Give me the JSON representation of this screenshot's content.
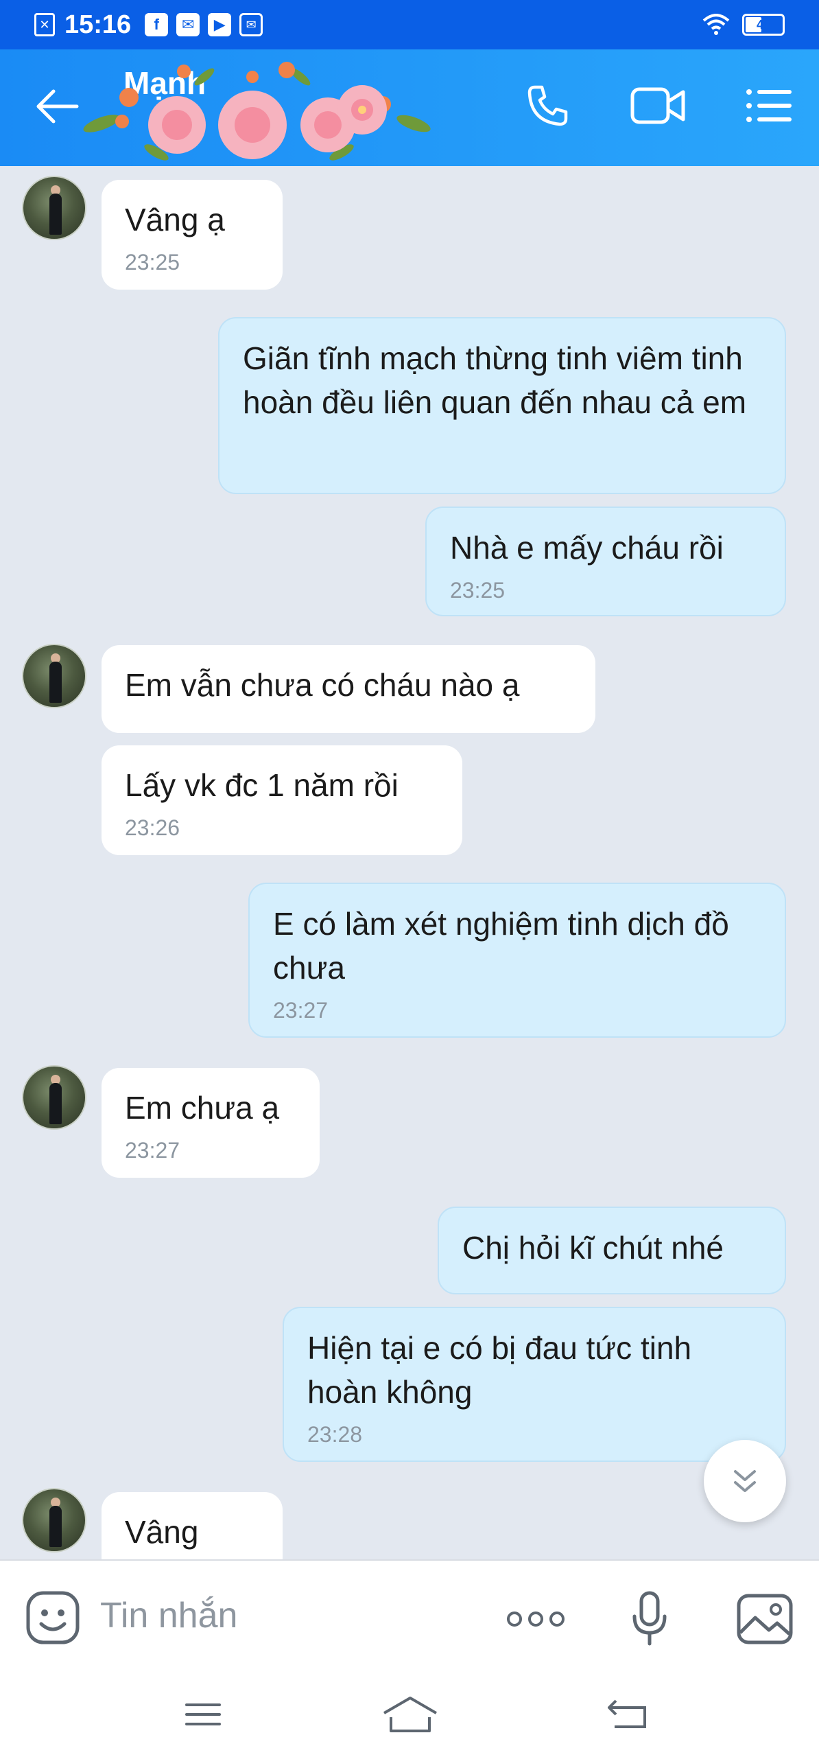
{
  "status_bar": {
    "time": "15:16",
    "battery": "48",
    "battery_level": 0.48,
    "icons": [
      "sim-icon",
      "facebook-icon",
      "mail-icon",
      "youtube-icon",
      "message-icon",
      "wifi-icon",
      "battery-icon"
    ]
  },
  "header": {
    "contact_name": "Mạnh",
    "icons": [
      "back-arrow-icon",
      "phone-icon",
      "video-call-icon",
      "menu-list-icon"
    ]
  },
  "messages": [
    {
      "side": "in",
      "avatar": true,
      "text": "Vâng ạ",
      "time": "23:25"
    },
    {
      "side": "out",
      "text": "Giãn tĩnh mạch thừng tinh viêm tinh hoàn đều liên quan đến nhau cả em",
      "time": ""
    },
    {
      "side": "out",
      "text": "Nhà e mấy cháu rồi",
      "time": "23:25"
    },
    {
      "side": "in",
      "avatar": true,
      "text": "Em vẫn chưa có cháu nào ạ",
      "time": ""
    },
    {
      "side": "in",
      "avatar": false,
      "text": "Lấy vk đc 1 năm rồi",
      "time": "23:26"
    },
    {
      "side": "out",
      "text": "E có làm xét nghiệm tinh dịch đồ chưa",
      "time": "23:27"
    },
    {
      "side": "in",
      "avatar": true,
      "text": "Em chưa ạ",
      "time": "23:27"
    },
    {
      "side": "out",
      "text": "Chị hỏi kĩ chút nhé",
      "time": ""
    },
    {
      "side": "out",
      "text": "Hiện tại e có bị đau tức tinh hoàn không",
      "time": "23:28"
    },
    {
      "side": "in",
      "avatar": true,
      "text": "Vâng",
      "time": ""
    }
  ],
  "input": {
    "placeholder": "Tin nhắn",
    "icons": [
      "emoji-icon",
      "more-dots-icon",
      "microphone-icon",
      "image-icon"
    ]
  },
  "nav": {
    "icons": [
      "recent-apps-icon",
      "home-icon",
      "back-icon"
    ]
  },
  "colors": {
    "status_bar": "#0a5fe6",
    "header": "#1a8bf5",
    "chat_bg": "#e3e8f0",
    "bubble_out": "#d5effd",
    "bubble_in": "#ffffff"
  }
}
